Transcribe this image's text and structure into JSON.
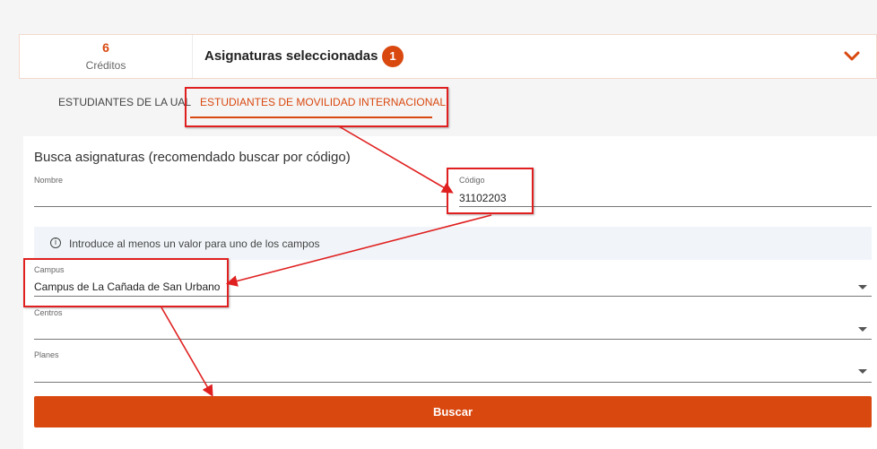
{
  "summary": {
    "credits_value": "6",
    "credits_label": "Créditos",
    "title": "Asignaturas seleccionadas",
    "badge": "1",
    "toggle_icon": "chevron-down-icon"
  },
  "tabs": [
    {
      "label": "ESTUDIANTES DE LA UAL",
      "active": false
    },
    {
      "label": "ESTUDIANTES DE MOVILIDAD INTERNACIONAL",
      "active": true
    }
  ],
  "search": {
    "title": "Busca asignaturas (recomendado buscar por código)",
    "nombre_label": "Nombre",
    "nombre_value": "",
    "codigo_label": "Código",
    "codigo_value": "31102203",
    "info_icon": "info-icon",
    "info_text": "Introduce al menos un valor para uno de los campos",
    "campus_label": "Campus",
    "campus_value": "Campus de La Cañada de San Urbano",
    "centros_label": "Centros",
    "centros_value": "",
    "planes_label": "Planes",
    "planes_value": "",
    "button_label": "Buscar"
  },
  "colors": {
    "accent": "#d9480f",
    "annotation": "#e02020",
    "info_background": "#f1f5f9"
  }
}
